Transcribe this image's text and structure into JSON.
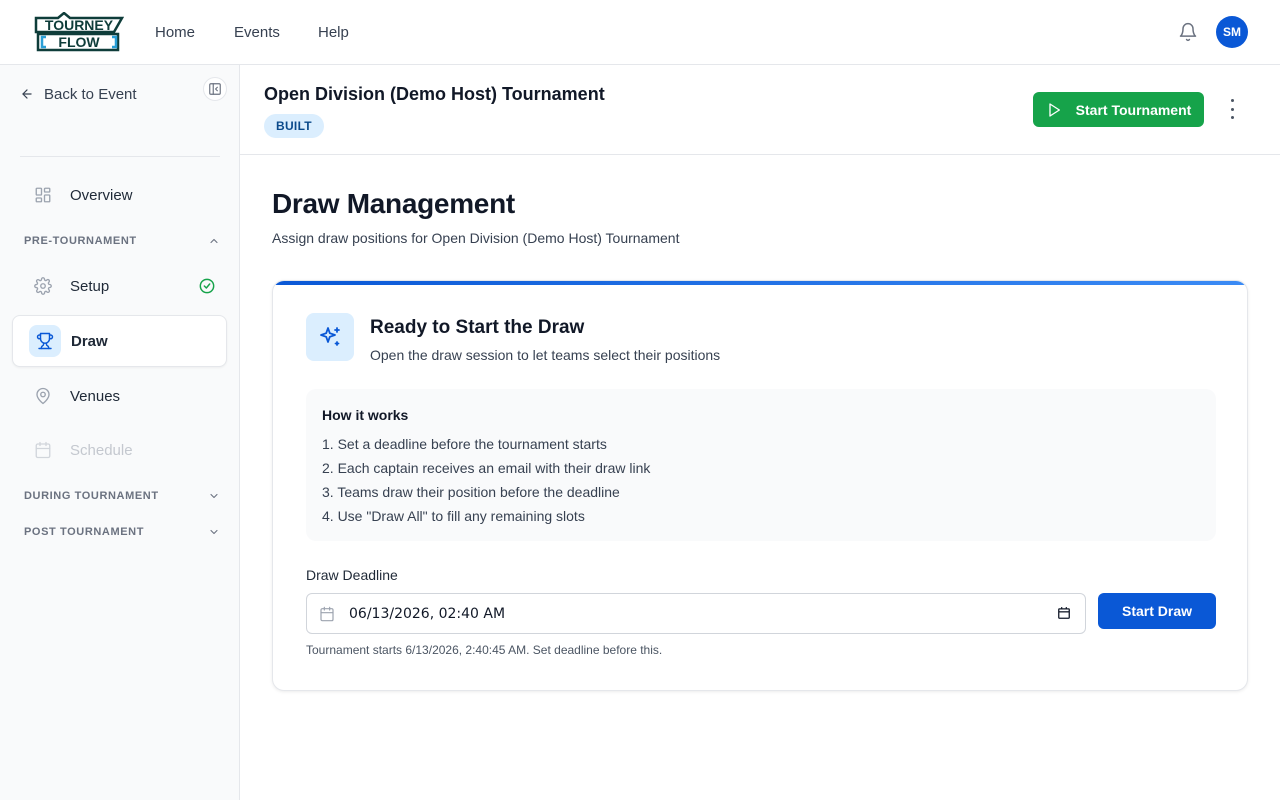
{
  "app": {
    "logo_line1": "TOURNEY",
    "logo_line2": "FLOW",
    "nav": [
      "Home",
      "Events",
      "Help"
    ],
    "avatar_initials": "SM",
    "brand_color": "#0a58d6"
  },
  "sidebar": {
    "back_label": "Back to Event",
    "overview_label": "Overview",
    "sections": {
      "pre": "PRE-TOURNAMENT",
      "during": "DURING TOURNAMENT",
      "post": "POST TOURNAMENT"
    },
    "items": [
      {
        "label": "Setup",
        "icon": "gear-icon",
        "status": "complete"
      },
      {
        "label": "Draw",
        "icon": "trophy-icon",
        "active": true
      },
      {
        "label": "Venues",
        "icon": "map-pin-icon"
      },
      {
        "label": "Schedule",
        "icon": "calendar-icon",
        "disabled": true
      }
    ]
  },
  "header": {
    "tournament_title": "Open Division (Demo Host) Tournament",
    "status_badge": "BUILT",
    "start_button": "Start Tournament"
  },
  "main": {
    "title": "Draw Management",
    "subtitle": "Assign draw positions for Open Division (Demo Host) Tournament"
  },
  "card": {
    "title": "Ready to Start the Draw",
    "subtitle": "Open the draw session to let teams select their positions",
    "how_title": "How it works",
    "steps": [
      "1. Set a deadline before the tournament starts",
      "2. Each captain receives an email with their draw link",
      "3. Teams draw their position before the deadline",
      "4. Use \"Draw All\" to fill any remaining slots"
    ],
    "deadline_label": "Draw Deadline",
    "deadline_value": "06/13/2026, 02:40 AM",
    "start_draw_button": "Start Draw",
    "hint": "Tournament starts 6/13/2026, 2:40:45 AM. Set deadline before this."
  }
}
